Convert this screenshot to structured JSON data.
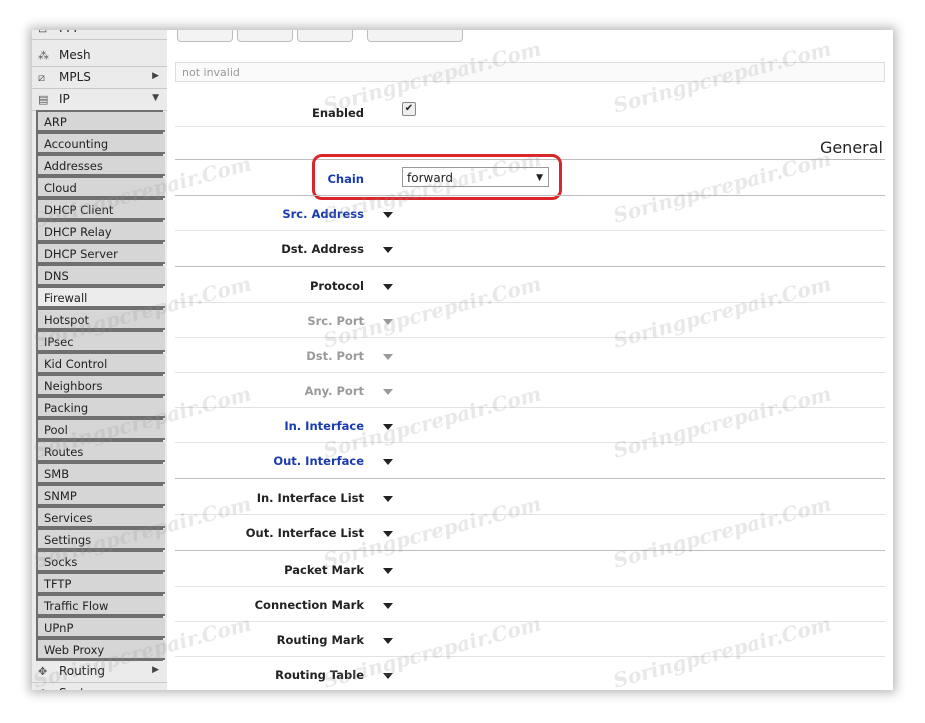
{
  "sidebar": {
    "top_items": [
      {
        "label": "PPP",
        "icon": "ppp-icon",
        "glyph": "⊟"
      },
      {
        "label": "Mesh",
        "icon": "mesh-icon",
        "glyph": "⁂"
      },
      {
        "label": "MPLS",
        "icon": "mpls-icon",
        "glyph": "⧄",
        "arrow": "▶"
      },
      {
        "label": "IP",
        "icon": "ip-icon",
        "glyph": "▤",
        "arrow": "▼"
      }
    ],
    "ip_submenu": [
      "ARP",
      "Accounting",
      "Addresses",
      "Cloud",
      "DHCP Client",
      "DHCP Relay",
      "DHCP Server",
      "DNS",
      "Firewall",
      "Hotspot",
      "IPsec",
      "Kid Control",
      "Neighbors",
      "Packing",
      "Pool",
      "Routes",
      "SMB",
      "SNMP",
      "Services",
      "Settings",
      "Socks",
      "TFTP",
      "Traffic Flow",
      "UPnP",
      "Web Proxy"
    ],
    "active_item": "Firewall",
    "bottom_items": [
      {
        "label": "Routing",
        "icon": "routing-icon",
        "glyph": "✥",
        "arrow": "▶"
      },
      {
        "label": "System",
        "icon": "system-icon",
        "glyph": "⚙"
      }
    ]
  },
  "form": {
    "comment_placeholder": "not invalid",
    "enabled_label": "Enabled",
    "enabled_checked": "✔",
    "section_general": "General",
    "chain_label": "Chain",
    "chain_value": "forward",
    "chain_arrow": "▼",
    "fields": [
      {
        "label": "Src. Address",
        "style": "blue"
      },
      {
        "label": "Dst. Address",
        "style": "dark"
      },
      {
        "label": "Protocol",
        "style": "dark"
      },
      {
        "label": "Src. Port",
        "style": "gray"
      },
      {
        "label": "Dst. Port",
        "style": "gray"
      },
      {
        "label": "Any. Port",
        "style": "gray"
      },
      {
        "label": "In. Interface",
        "style": "blue"
      },
      {
        "label": "Out. Interface",
        "style": "blue"
      },
      {
        "label": "In. Interface List",
        "style": "dark"
      },
      {
        "label": "Out. Interface List",
        "style": "dark"
      },
      {
        "label": "Packet Mark",
        "style": "dark"
      },
      {
        "label": "Connection Mark",
        "style": "dark"
      },
      {
        "label": "Routing Mark",
        "style": "dark"
      },
      {
        "label": "Routing Table",
        "style": "dark"
      }
    ]
  },
  "watermark": "Soringpcrepair.Com",
  "colors": {
    "highlight": "#d8262b",
    "blue_label": "#1a3bb0",
    "active_menu": "#ececec"
  }
}
